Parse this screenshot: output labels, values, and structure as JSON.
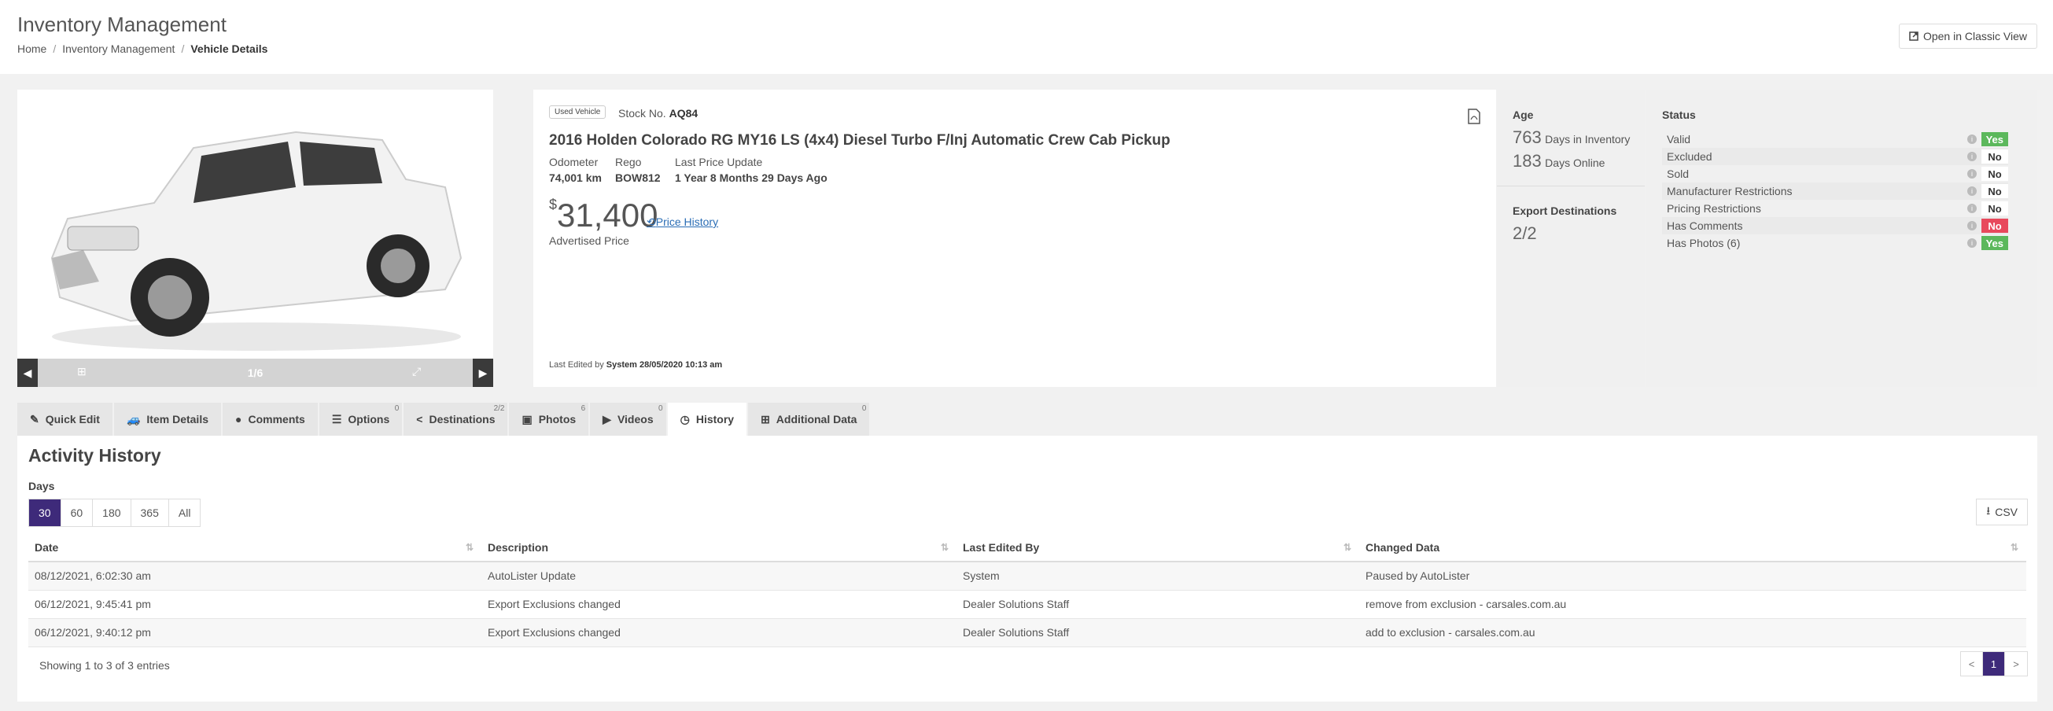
{
  "header": {
    "title": "Inventory Management",
    "breadcrumb": [
      "Home",
      "Inventory Management",
      "Vehicle Details"
    ],
    "classic_view_label": "Open in Classic View"
  },
  "gallery": {
    "counter": "1/6"
  },
  "vehicle": {
    "badge": "Used Vehicle",
    "stock_label": "Stock No.",
    "stock_no": "AQ84",
    "title": "2016 Holden Colorado RG MY16 LS (4x4) Diesel Turbo F/Inj Automatic Crew Cab Pickup",
    "odometer_label": "Odometer",
    "odometer": "74,001 km",
    "rego_label": "Rego",
    "rego": "BOW812",
    "last_price_update_label": "Last Price Update",
    "last_price_update": "1 Year 8 Months 29 Days Ago",
    "currency_symbol": "$",
    "price": "31,400",
    "price_history_label": "Price History",
    "advertised_label": "Advertised Price",
    "last_edited_label": "Last Edited by",
    "last_edited_value": "System 28/05/2020 10:13 am"
  },
  "age": {
    "heading": "Age",
    "days_inventory": "763",
    "days_inventory_label": "Days in Inventory",
    "days_online": "183",
    "days_online_label": "Days Online",
    "export_heading": "Export Destinations",
    "export_value": "2/2"
  },
  "status": {
    "heading": "Status",
    "rows": [
      {
        "label": "Valid",
        "value": "Yes",
        "color": "#5cb85c"
      },
      {
        "label": "Excluded",
        "value": "No",
        "color": ""
      },
      {
        "label": "Sold",
        "value": "No",
        "color": ""
      },
      {
        "label": "Manufacturer Restrictions",
        "value": "No",
        "color": ""
      },
      {
        "label": "Pricing Restrictions",
        "value": "No",
        "color": ""
      },
      {
        "label": "Has Comments",
        "value": "No",
        "color": "#e8495c"
      },
      {
        "label": "Has Photos (6)",
        "value": "Yes",
        "color": "#5cb85c"
      }
    ]
  },
  "tabs": [
    {
      "label": "Quick Edit",
      "count": "",
      "icon": "edit-icon"
    },
    {
      "label": "Item Details",
      "count": "",
      "icon": "car-icon"
    },
    {
      "label": "Comments",
      "count": "",
      "icon": "comment-icon"
    },
    {
      "label": "Options",
      "count": "0",
      "icon": "list-icon"
    },
    {
      "label": "Destinations",
      "count": "2/2",
      "icon": "share-icon"
    },
    {
      "label": "Photos",
      "count": "6",
      "icon": "image-icon"
    },
    {
      "label": "Videos",
      "count": "0",
      "icon": "play-icon"
    },
    {
      "label": "History",
      "count": "",
      "icon": "clock-icon",
      "active": true
    },
    {
      "label": "Additional Data",
      "count": "0",
      "icon": "plus-square-icon"
    }
  ],
  "history": {
    "title": "Activity History",
    "days_label": "Days",
    "days_options": [
      "30",
      "60",
      "180",
      "365",
      "All"
    ],
    "days_selected": "30",
    "csv_label": "CSV",
    "columns": [
      "Date",
      "Description",
      "Last Edited By",
      "Changed Data"
    ],
    "rows": [
      [
        "08/12/2021, 6:02:30 am",
        "AutoLister Update",
        "System",
        "Paused by AutoLister"
      ],
      [
        "06/12/2021, 9:45:41 pm",
        "Export Exclusions changed",
        "Dealer Solutions Staff",
        "remove from exclusion - carsales.com.au"
      ],
      [
        "06/12/2021, 9:40:12 pm",
        "Export Exclusions changed",
        "Dealer Solutions Staff",
        "add to exclusion - carsales.com.au"
      ]
    ],
    "entries_text": "Showing 1 to 3 of 3 entries",
    "pager": {
      "prev": "<",
      "page": "1",
      "next": ">"
    }
  }
}
